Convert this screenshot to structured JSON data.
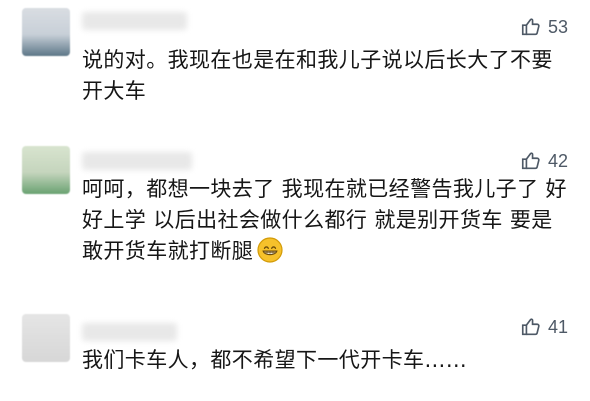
{
  "comments": [
    {
      "likes": "53",
      "text": "说的对。我现在也是在和我儿子说以后长大了不要开大车"
    },
    {
      "likes": "42",
      "text": "呵呵，都想一块去了 我现在就已经警告我儿子了 好好上学 以后出社会做什么都行 就是别开货车 要是敢开货车就打断腿"
    },
    {
      "likes": "41",
      "text": "我们卡车人，都不希望下一代开卡车……"
    }
  ],
  "icons": {
    "like": "thumbs-up-icon",
    "emoji": "grinning-face-icon"
  },
  "colors": {
    "text": "#161616",
    "like_gray": "#4e5966",
    "background": "#ffffff"
  }
}
